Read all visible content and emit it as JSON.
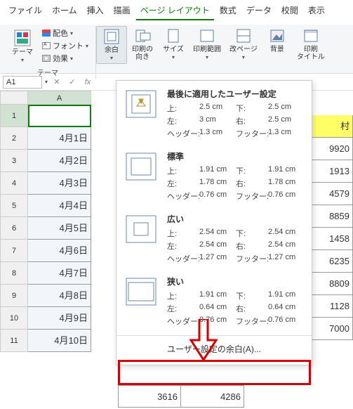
{
  "menus": [
    "ファイル",
    "ホーム",
    "挿入",
    "描画",
    "ページ レイアウト",
    "数式",
    "データ",
    "校閲",
    "表示"
  ],
  "active_menu_index": 4,
  "theme": {
    "btn": "テーマ",
    "colors": "配色",
    "fonts": "フォント",
    "effects": "効果",
    "group": "テーマ"
  },
  "page_btns": {
    "margins": "余白",
    "orientation": "印刷の\n向き",
    "size": "サイズ",
    "area": "印刷範囲",
    "breaks": "改ページ",
    "background": "背景",
    "titles": "印刷\nタイトル"
  },
  "namebox": "A1",
  "colA_header": "A",
  "rows": [
    {
      "n": "1",
      "a": ""
    },
    {
      "n": "2",
      "a": "4月1日"
    },
    {
      "n": "3",
      "a": "4月2日"
    },
    {
      "n": "4",
      "a": "4月3日"
    },
    {
      "n": "5",
      "a": "4月4日"
    },
    {
      "n": "6",
      "a": "4月5日"
    },
    {
      "n": "7",
      "a": "4月6日"
    },
    {
      "n": "8",
      "a": "4月7日"
    },
    {
      "n": "9",
      "a": "4月8日"
    },
    {
      "n": "10",
      "a": "4月9日"
    },
    {
      "n": "11",
      "a": "4月10日"
    }
  ],
  "rightcol": [
    "村",
    "9920",
    "1913",
    "4579",
    "8859",
    "1458",
    "6235",
    "8809",
    "1128",
    "7000"
  ],
  "rightcol_mid": "4286",
  "dd": {
    "last": {
      "title": "最後に適用したユーザー設定",
      "top_k": "上:",
      "top_v": "2.5 cm",
      "bottom_k": "下:",
      "bottom_v": "2.5 cm",
      "left_k": "左:",
      "left_v": "3 cm",
      "right_k": "右:",
      "right_v": "2.5 cm",
      "head_k": "ヘッダー:",
      "head_v": "1.3 cm",
      "foot_k": "フッター:",
      "foot_v": "1.3 cm"
    },
    "normal": {
      "title": "標準",
      "top_k": "上:",
      "top_v": "1.91 cm",
      "bottom_k": "下:",
      "bottom_v": "1.91 cm",
      "left_k": "左:",
      "left_v": "1.78 cm",
      "right_k": "右:",
      "right_v": "1.78 cm",
      "head_k": "ヘッダー:",
      "head_v": "0.76 cm",
      "foot_k": "フッター:",
      "foot_v": "0.76 cm"
    },
    "wide": {
      "title": "広い",
      "top_k": "上:",
      "top_v": "2.54 cm",
      "bottom_k": "下:",
      "bottom_v": "2.54 cm",
      "left_k": "左:",
      "left_v": "2.54 cm",
      "right_k": "右:",
      "right_v": "2.54 cm",
      "head_k": "ヘッダー:",
      "head_v": "1.27 cm",
      "foot_k": "フッター:",
      "foot_v": "1.27 cm"
    },
    "narrow": {
      "title": "狭い",
      "top_k": "上:",
      "top_v": "1.91 cm",
      "bottom_k": "下:",
      "bottom_v": "1.91 cm",
      "left_k": "左:",
      "left_v": "0.64 cm",
      "right_k": "右:",
      "right_v": "0.64 cm",
      "head_k": "ヘッダー:",
      "head_v": "0.76 cm",
      "foot_k": "フッター:",
      "foot_v": "0.76 cm"
    },
    "custom": "ユーザー設定の余白(A)...",
    "mid_num": "3616"
  }
}
